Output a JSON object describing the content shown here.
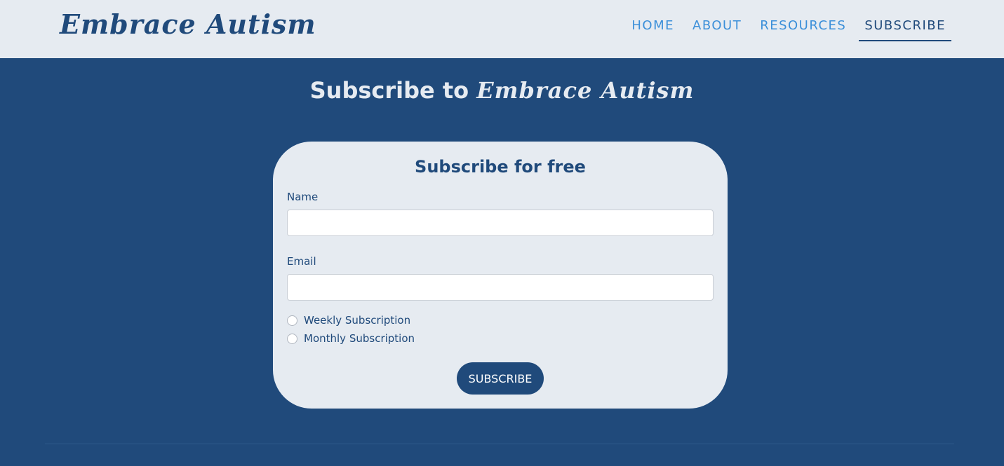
{
  "brand": "Embrace Autism",
  "nav": {
    "items": [
      {
        "label": "HOME",
        "active": false
      },
      {
        "label": "ABOUT",
        "active": false
      },
      {
        "label": "RESOURCES",
        "active": false
      },
      {
        "label": "SUBSCRIBE",
        "active": true
      }
    ]
  },
  "page": {
    "heading_prefix": "Subscribe to",
    "heading_brand": "Embrace Autism"
  },
  "form": {
    "title": "Subscribe for free",
    "name_label": "Name",
    "name_value": "",
    "email_label": "Email",
    "email_value": "",
    "options": [
      {
        "label": "Weekly Subscription",
        "checked": false
      },
      {
        "label": "Monthly Subscription",
        "checked": false
      }
    ],
    "submit_label": "SUBSCRIBE"
  },
  "colors": {
    "primary": "#204a7b",
    "nav_link": "#3b8fd9",
    "light_bg": "#e6ebf1"
  }
}
